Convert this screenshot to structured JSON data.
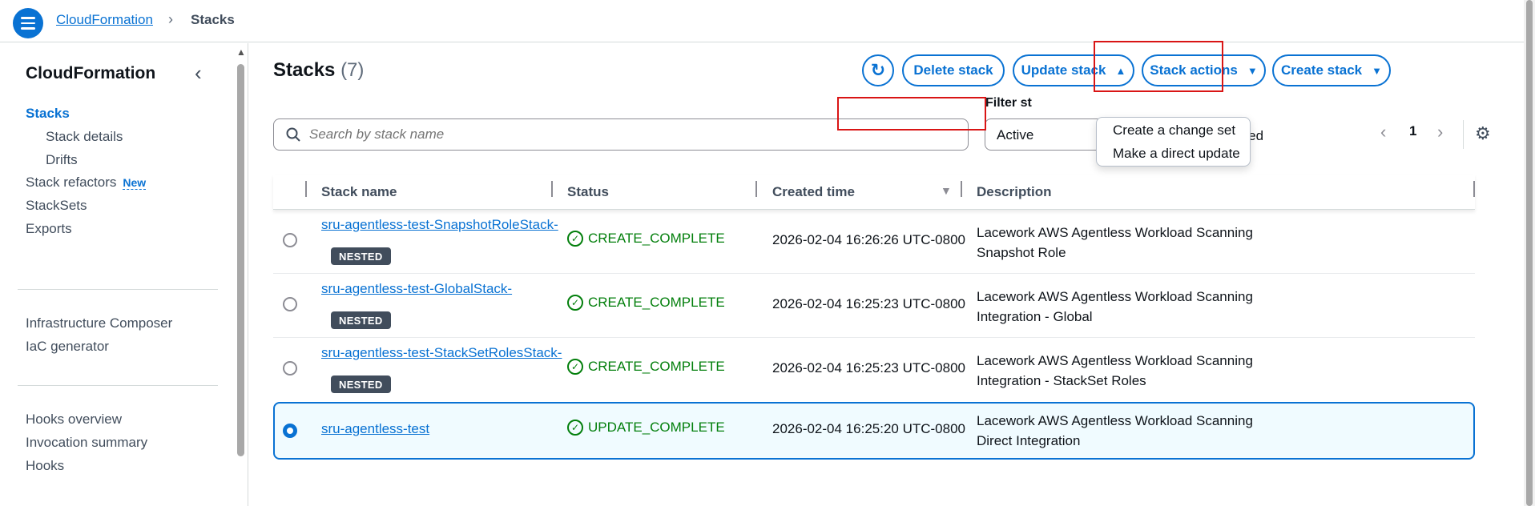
{
  "breadcrumb": {
    "root": "CloudFormation",
    "separator": "›",
    "current": "Stacks"
  },
  "sidebar": {
    "title": "CloudFormation",
    "items": [
      {
        "label": "Stacks",
        "active": true
      },
      {
        "label": "Stack details"
      },
      {
        "label": "Drifts"
      },
      {
        "label": "Stack refactors",
        "badge": "New"
      },
      {
        "label": "StackSets"
      },
      {
        "label": "Exports"
      },
      {
        "label": "Infrastructure Composer"
      },
      {
        "label": "IaC generator"
      },
      {
        "label": "Hooks overview"
      },
      {
        "label": "Invocation summary"
      },
      {
        "label": "Hooks"
      }
    ]
  },
  "header": {
    "title": "Stacks",
    "count": "(7)",
    "buttons": {
      "delete": "Delete stack",
      "update": "Update stack",
      "actions": "Stack actions",
      "create": "Create stack"
    }
  },
  "dropdown": {
    "items": [
      "Create a change set",
      "Make a direct update"
    ]
  },
  "filters": {
    "search_placeholder": "Search by stack name",
    "status_label": "Filter st",
    "status_value": "Active",
    "nested_label": "nested"
  },
  "pagination": {
    "page": "1"
  },
  "table": {
    "columns": [
      "Stack name",
      "Status",
      "Created time",
      "Description"
    ],
    "rows": [
      {
        "name": "sru-agentless-test-SnapshotRoleStack-",
        "nested": "NESTED",
        "status": "CREATE_COMPLETE",
        "created": "2026-02-04 16:26:26 UTC-0800",
        "description": "Lacework AWS Agentless Workload Scanning Snapshot Role",
        "selected": false
      },
      {
        "name": "sru-agentless-test-GlobalStack-",
        "nested": "NESTED",
        "status": "CREATE_COMPLETE",
        "created": "2026-02-04 16:25:23 UTC-0800",
        "description": "Lacework AWS Agentless Workload Scanning Integration - Global",
        "selected": false
      },
      {
        "name": "sru-agentless-test-StackSetRolesStack-",
        "nested": "NESTED",
        "status": "CREATE_COMPLETE",
        "created": "2026-02-04 16:25:23 UTC-0800",
        "description": "Lacework AWS Agentless Workload Scanning Integration - StackSet Roles",
        "selected": false
      },
      {
        "name": "sru-agentless-test",
        "status": "UPDATE_COMPLETE",
        "created": "2026-02-04 16:25:20 UTC-0800",
        "description": "Lacework AWS Agentless Workload Scanning Direct Integration",
        "selected": true
      }
    ]
  },
  "colors": {
    "accent": "#0972d3",
    "success": "#037f0c",
    "highlight": "#d91515"
  }
}
